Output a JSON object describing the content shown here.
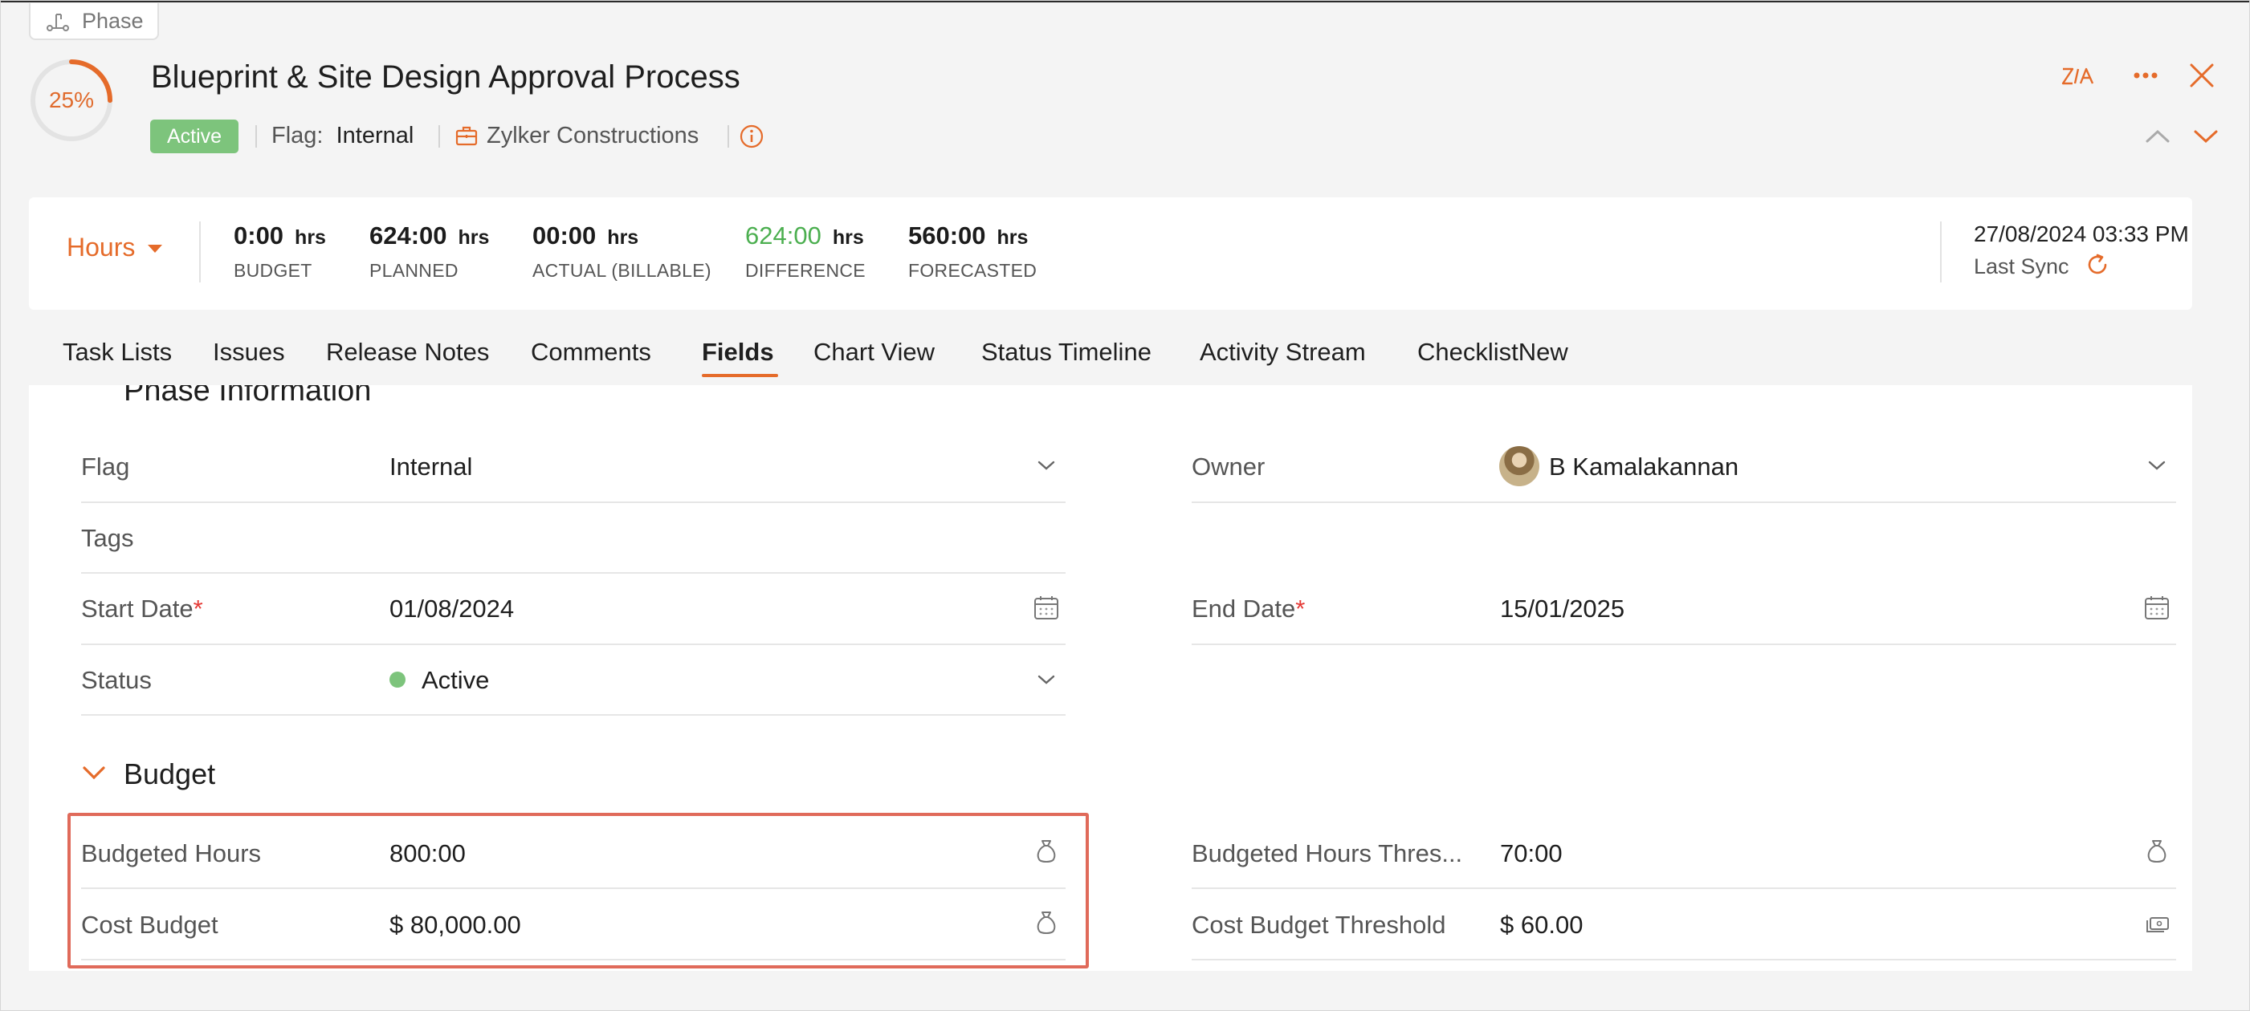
{
  "phase_chip": {
    "label": "Phase",
    "icon": "phase-icon"
  },
  "progress": {
    "percent": 25,
    "label": "25%",
    "color": "#e56b2a"
  },
  "title": "Blueprint & Site Design Approval Process",
  "status_badge": "Active",
  "flag": {
    "label": "Flag:",
    "value": "Internal"
  },
  "client": {
    "name": "Zylker Constructions",
    "icon": "briefcase-icon"
  },
  "header_actions": [
    "zia-icon",
    "more-icon",
    "close-icon",
    "chevron-up-icon",
    "chevron-down-icon"
  ],
  "stats": {
    "unit_selector": "Hours",
    "items": [
      {
        "value": "0:00",
        "unit": "hrs",
        "label": "BUDGET"
      },
      {
        "value": "624:00",
        "unit": "hrs",
        "label": "PLANNED"
      },
      {
        "value": "00:00",
        "unit": "hrs",
        "label": "ACTUAL (BILLABLE)"
      },
      {
        "value": "624:00",
        "unit": "hrs",
        "label": "DIFFERENCE",
        "color": "#4caf50"
      },
      {
        "value": "560:00",
        "unit": "hrs",
        "label": "FORECASTED"
      }
    ]
  },
  "sync": {
    "datetime": "27/08/2024 03:33 PM",
    "label": "Last Sync"
  },
  "tabs": [
    "Task Lists",
    "Issues",
    "Release Notes",
    "Comments",
    "Fields",
    "Chart View",
    "Status Timeline",
    "Activity Stream",
    "ChecklistNew"
  ],
  "active_tab": "Fields",
  "phase_info": {
    "section_title": "Phase Information",
    "fields": {
      "flag": {
        "label": "Flag",
        "value": "Internal"
      },
      "owner": {
        "label": "Owner",
        "value": "B Kamalakannan"
      },
      "tags": {
        "label": "Tags",
        "value": ""
      },
      "start_date": {
        "label": "Start Date",
        "value": "01/08/2024",
        "required": "*"
      },
      "end_date": {
        "label": "End Date",
        "value": "15/01/2025",
        "required": "*"
      },
      "status": {
        "label": "Status",
        "value": "Active"
      }
    }
  },
  "budget": {
    "section_title": "Budget",
    "fields": {
      "budgeted_hours": {
        "label": "Budgeted Hours",
        "value": "800:00"
      },
      "cost_budget": {
        "label": "Cost Budget",
        "value": "$ 80,000.00"
      },
      "budgeted_hours_threshold": {
        "label": "Budgeted Hours Thres...",
        "value": "70:00"
      },
      "cost_budget_threshold": {
        "label": "Cost Budget Threshold",
        "value": "$ 60.00"
      }
    }
  },
  "colors": {
    "accent": "#e56b2a",
    "active_green": "#7dc47c",
    "highlight": "#e06a5a"
  }
}
